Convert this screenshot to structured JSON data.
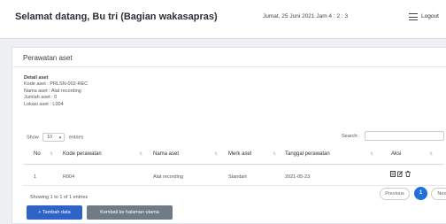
{
  "header": {
    "welcome": "Selamat datang, Bu tri (Bagian wakasapras)",
    "datetime": "Jumat, 25 Juni 2021  Jam 4 : 2 : 3",
    "logout_label": "Logout"
  },
  "card": {
    "title": "Perawatan aset",
    "detail": {
      "heading": "Detail aset",
      "kode_aset": "Kode aset   : PRLSN-002-REC",
      "nama_aset": "Nama aset   : Alat recording",
      "jumlah_aset": "Jumlah aset  : 0",
      "lokasi_aset": "Lokasi aset   : L004"
    }
  },
  "table_controls": {
    "show_label": "Show",
    "entries_value": "10",
    "entries_label": "entries",
    "search_label": "Search:",
    "search_value": ""
  },
  "table": {
    "columns": [
      "No",
      "Kode perawatan",
      "Nama aset",
      "Merk aset",
      "Tanggal perawatan",
      "Aksi"
    ],
    "rows": [
      {
        "no": "1",
        "kode": "R004",
        "nama": "Alat recording",
        "merk": "Standart",
        "tanggal": "2021-05-23"
      }
    ],
    "action_icons": [
      "detail-icon",
      "edit-icon",
      "delete-icon"
    ]
  },
  "pagination": {
    "info": "Showing 1 to 1 of 1 entries",
    "previous": "Previous",
    "current_page": "1",
    "next": "Next"
  },
  "buttons": {
    "add": "+ Tambah data",
    "back": "Kembali ke halaman utama"
  },
  "colors": {
    "primary": "#2e64c8",
    "page_active": "#1f6fde",
    "secondary_button": "#6f7c88"
  }
}
